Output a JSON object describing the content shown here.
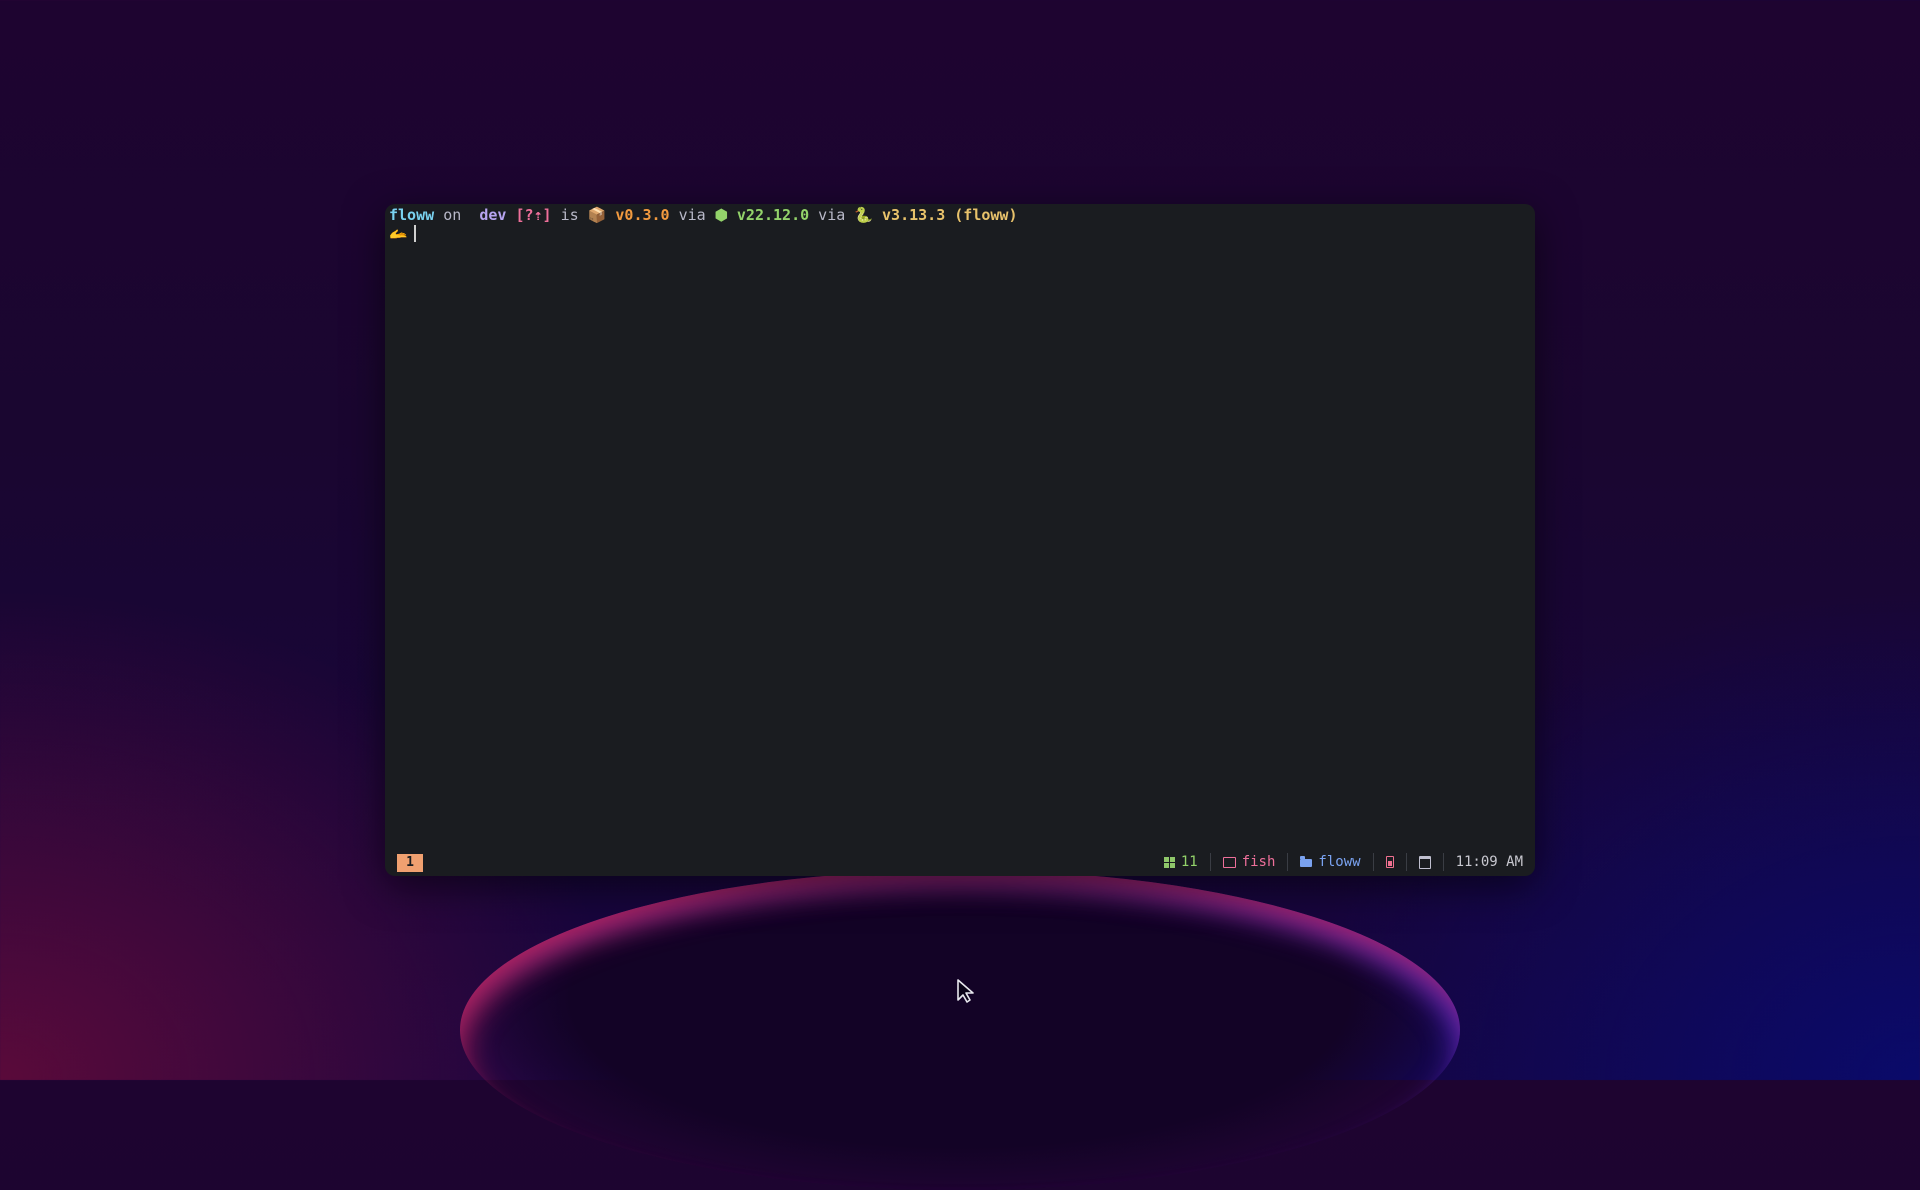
{
  "prompt": {
    "dir": "floww",
    "on": "on",
    "branch_icon": "git-branch-icon",
    "branch": "dev",
    "status": "[?⇡]",
    "is": "is",
    "package_icon": "📦",
    "pkg_version": "v0.3.0",
    "via1": "via",
    "node_icon": "⬢",
    "node_version": "v22.12.0",
    "via2": "via",
    "python_icon": "🐍",
    "python_version": "v3.13.3 (floww)",
    "symbol": "🫴"
  },
  "statusbar": {
    "tab": "1",
    "windows_count": "11",
    "shell": "fish",
    "directory": "floww",
    "time": "11:09 AM"
  }
}
